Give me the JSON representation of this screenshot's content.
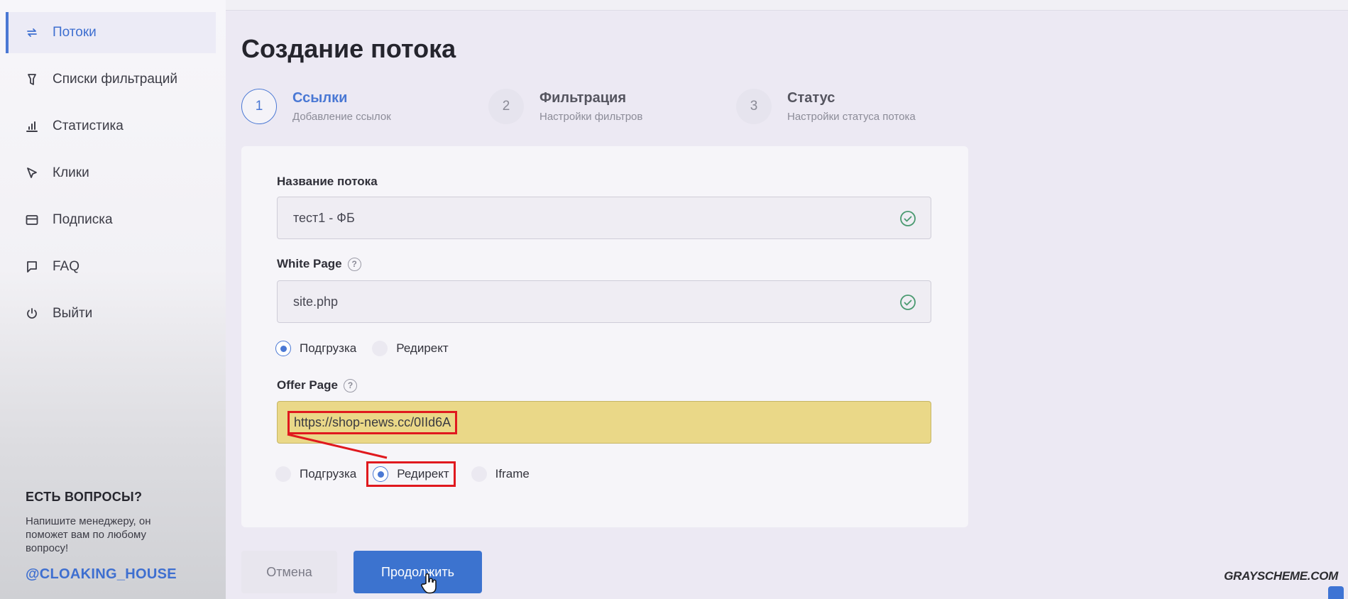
{
  "sidebar": {
    "items": [
      {
        "label": "Потоки",
        "icon": "refresh-icon"
      },
      {
        "label": "Списки фильтраций",
        "icon": "filter-icon"
      },
      {
        "label": "Статистика",
        "icon": "bar-chart-icon"
      },
      {
        "label": "Клики",
        "icon": "cursor-icon"
      },
      {
        "label": "Подписка",
        "icon": "card-icon"
      },
      {
        "label": "FAQ",
        "icon": "chat-icon"
      },
      {
        "label": "Выйти",
        "icon": "power-icon"
      }
    ],
    "help": {
      "title": "ЕСТЬ ВОПРОСЫ?",
      "text": "Напишите менеджеру, он поможет вам по любому вопросу!",
      "handle": "@CLOAKING_HOUSE"
    }
  },
  "page": {
    "title": "Создание потока"
  },
  "steps": [
    {
      "num": "1",
      "title": "Ссылки",
      "subtitle": "Добавление ссылок",
      "active": true
    },
    {
      "num": "2",
      "title": "Фильтрация",
      "subtitle": "Настройки фильтров",
      "active": false
    },
    {
      "num": "3",
      "title": "Статус",
      "subtitle": "Настройки статуса потока",
      "active": false
    }
  ],
  "form": {
    "name_label": "Название потока",
    "name_value": "тест1 - ФБ",
    "white_label": "White Page",
    "white_value": "site.php",
    "white_options": {
      "option1": "Подгрузка",
      "option2": "Редирект"
    },
    "offer_label": "Offer Page",
    "offer_value": "https://shop-news.cc/0IId6A",
    "offer_options": {
      "option1": "Подгрузка",
      "option2": "Редирект",
      "option3": "Iframe"
    }
  },
  "actions": {
    "cancel": "Отмена",
    "continue": "Продолжить"
  },
  "watermark": "GRAYSCHEME.COM",
  "colors": {
    "accent": "#3c73cf",
    "highlight": "#e0191e",
    "offer_bg": "#ead888"
  }
}
